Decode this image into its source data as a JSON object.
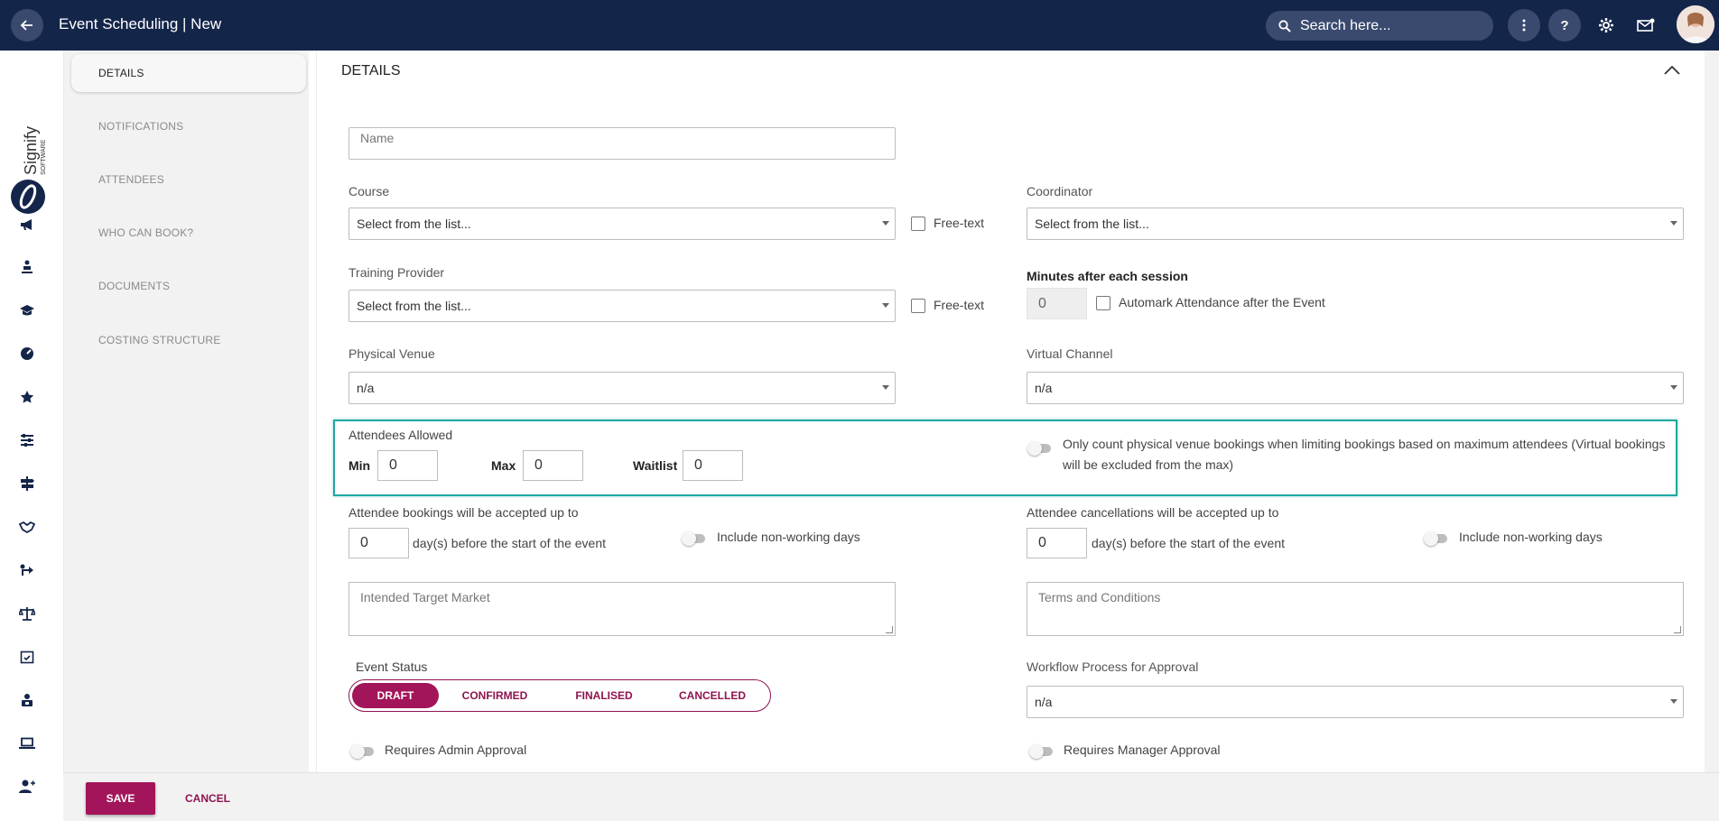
{
  "header": {
    "title": "Event Scheduling | New",
    "search_placeholder": "Search here...",
    "icons": [
      "back-arrow-icon",
      "search-icon",
      "more-vert-icon",
      "help-icon",
      "gear-icon",
      "mail-icon"
    ]
  },
  "brand": {
    "logo_text": "Signify",
    "logo_subtext": "SOFTWARE",
    "accent_color": "#a3155a",
    "nav_color": "#14254a",
    "highlight_color": "#1fa7a1"
  },
  "rail_icons": [
    "megaphone-icon",
    "person-lecture-icon",
    "graduation-cap-icon",
    "dashboard-gauge-icon",
    "star-icon",
    "sliders-icon",
    "signpost-icon",
    "handshake-icon",
    "route-icon",
    "scales-icon",
    "calendar-check-icon",
    "person-badge-icon",
    "laptop-icon",
    "person-add-icon"
  ],
  "section_nav": {
    "items": [
      {
        "label": "DETAILS",
        "active": true
      },
      {
        "label": "NOTIFICATIONS",
        "active": false
      },
      {
        "label": "ATTENDEES",
        "active": false
      },
      {
        "label": "WHO CAN BOOK?",
        "active": false
      },
      {
        "label": "DOCUMENTS",
        "active": false
      },
      {
        "label": "COSTING STRUCTURE",
        "active": false
      }
    ]
  },
  "form": {
    "section_title": "DETAILS",
    "name_placeholder": "Name",
    "course": {
      "label": "Course",
      "value": "Select from the list...",
      "freetext_label": "Free-text"
    },
    "coordinator": {
      "label": "Coordinator",
      "value": "Select from the list..."
    },
    "training_provider": {
      "label": "Training Provider",
      "value": "Select from the list...",
      "freetext_label": "Free-text"
    },
    "minutes_after": {
      "label": "Minutes after each session",
      "value": "0",
      "automark_label": "Automark Attendance after the Event"
    },
    "physical_venue": {
      "label": "Physical Venue",
      "value": "n/a"
    },
    "virtual_channel": {
      "label": "Virtual Channel",
      "value": "n/a"
    },
    "attendees_allowed": {
      "label": "Attendees Allowed",
      "min_label": "Min",
      "min_value": "0",
      "max_label": "Max",
      "max_value": "0",
      "waitlist_label": "Waitlist",
      "waitlist_value": "0",
      "physical_only_label": "Only count physical venue bookings when limiting bookings based on maximum attendees (Virtual bookings will be excluded from the max)"
    },
    "bookings_cutoff": {
      "label": "Attendee bookings will be accepted up to",
      "value": "0",
      "suffix": "day(s) before the start of the event",
      "nonworking_label": "Include non-working days"
    },
    "cancellations_cutoff": {
      "label": "Attendee cancellations will be accepted up to",
      "value": "0",
      "suffix": "day(s) before the start of the event",
      "nonworking_label": "Include non-working days"
    },
    "target_market_placeholder": "Intended Target Market",
    "terms_placeholder": "Terms and Conditions",
    "event_status": {
      "label": "Event Status",
      "options": [
        "DRAFT",
        "CONFIRMED",
        "FINALISED",
        "CANCELLED"
      ],
      "selected": "DRAFT"
    },
    "workflow": {
      "label": "Workflow Process for Approval",
      "value": "n/a"
    },
    "admin_approval_label": "Requires Admin Approval",
    "manager_approval_label": "Requires Manager Approval"
  },
  "footer": {
    "save_label": "SAVE",
    "cancel_label": "CANCEL"
  }
}
